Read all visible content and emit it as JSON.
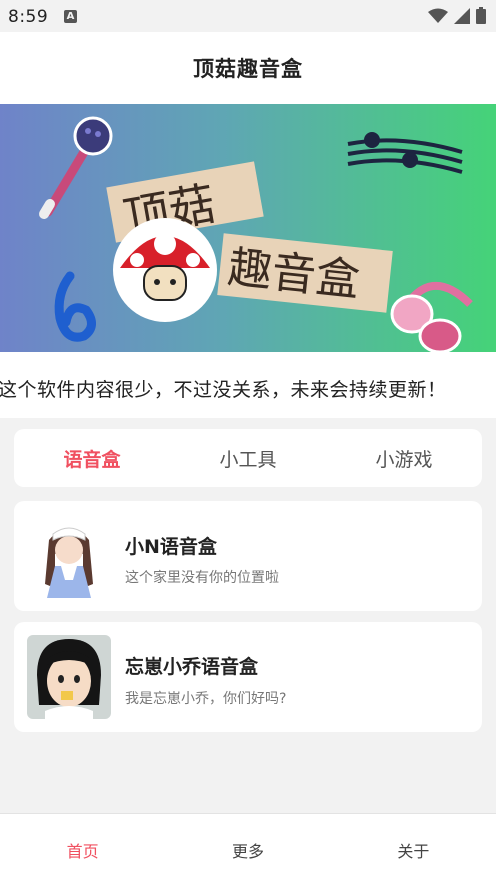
{
  "status_bar": {
    "time": "8:59",
    "notification_badge": "A"
  },
  "app_bar": {
    "title": "顶菇趣音盒"
  },
  "banner": {
    "art_text": [
      "顶菇",
      "趣音盒"
    ]
  },
  "marquee": {
    "text": "这个软件内容很少，不过没关系，未来会持续更新！"
  },
  "tabs": [
    {
      "label": "语音盒",
      "active": true
    },
    {
      "label": "小工具",
      "active": false
    },
    {
      "label": "小游戏",
      "active": false
    }
  ],
  "cards": [
    {
      "title": "小N语音盒",
      "subtitle": "这个家里没有你的位置啦"
    },
    {
      "title": "忘崽小乔语音盒",
      "subtitle": "我是忘崽小乔，你们好吗?"
    }
  ],
  "bottom_nav": [
    {
      "label": "首页",
      "active": true
    },
    {
      "label": "更多",
      "active": false
    },
    {
      "label": "关于",
      "active": false
    }
  ],
  "colors": {
    "accent": "#f05060",
    "banner_left": "#6b86c8",
    "banner_right": "#4bd27a"
  }
}
